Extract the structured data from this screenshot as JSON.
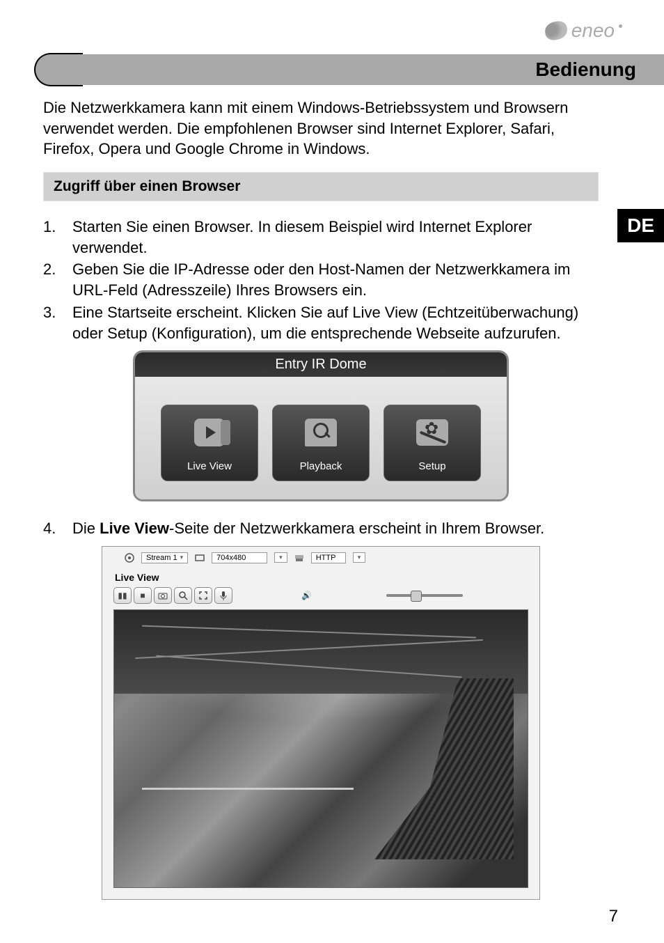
{
  "brand": "eneo",
  "header": {
    "title": "Bedienung"
  },
  "lang_tab": "DE",
  "intro": "Die Netzwerkkamera kann mit einem Windows-Betriebssystem und Browsern verwendet werden. Die empfohlenen Browser sind Internet Explorer, Safari, Firefox, Opera und Google Chrome in Windows.",
  "section1_title": "Zugriff über einen Browser",
  "steps": {
    "s1_num": "1.",
    "s1": "Starten Sie einen Browser. In diesem Beispiel wird Internet Explorer verwendet.",
    "s2_num": "2.",
    "s2": "Geben Sie die IP-Adresse oder den Host-Namen der Netzwerkkamera im URL-Feld (Adresszeile) Ihres Browsers ein.",
    "s3_num": "3.",
    "s3": "Eine Startseite erscheint. Klicken Sie auf Live View (Echtzeitüberwachung) oder Setup (Konfiguration), um die entsprechende Webseite aufzurufen.",
    "s4_num": "4.",
    "s4_pre": "Die ",
    "s4_bold": "Live View",
    "s4_post": "-Seite der Netzwerkkamera erscheint in Ihrem Browser."
  },
  "fig1": {
    "title": "Entry IR Dome",
    "tile_liveview": "Live View",
    "tile_playback": "Playback",
    "tile_setup": "Setup"
  },
  "fig2": {
    "stream_label": "Stream 1",
    "resolution": "704x480",
    "protocol": "HTTP",
    "liveview_label": "Live View"
  },
  "page_number": "7"
}
